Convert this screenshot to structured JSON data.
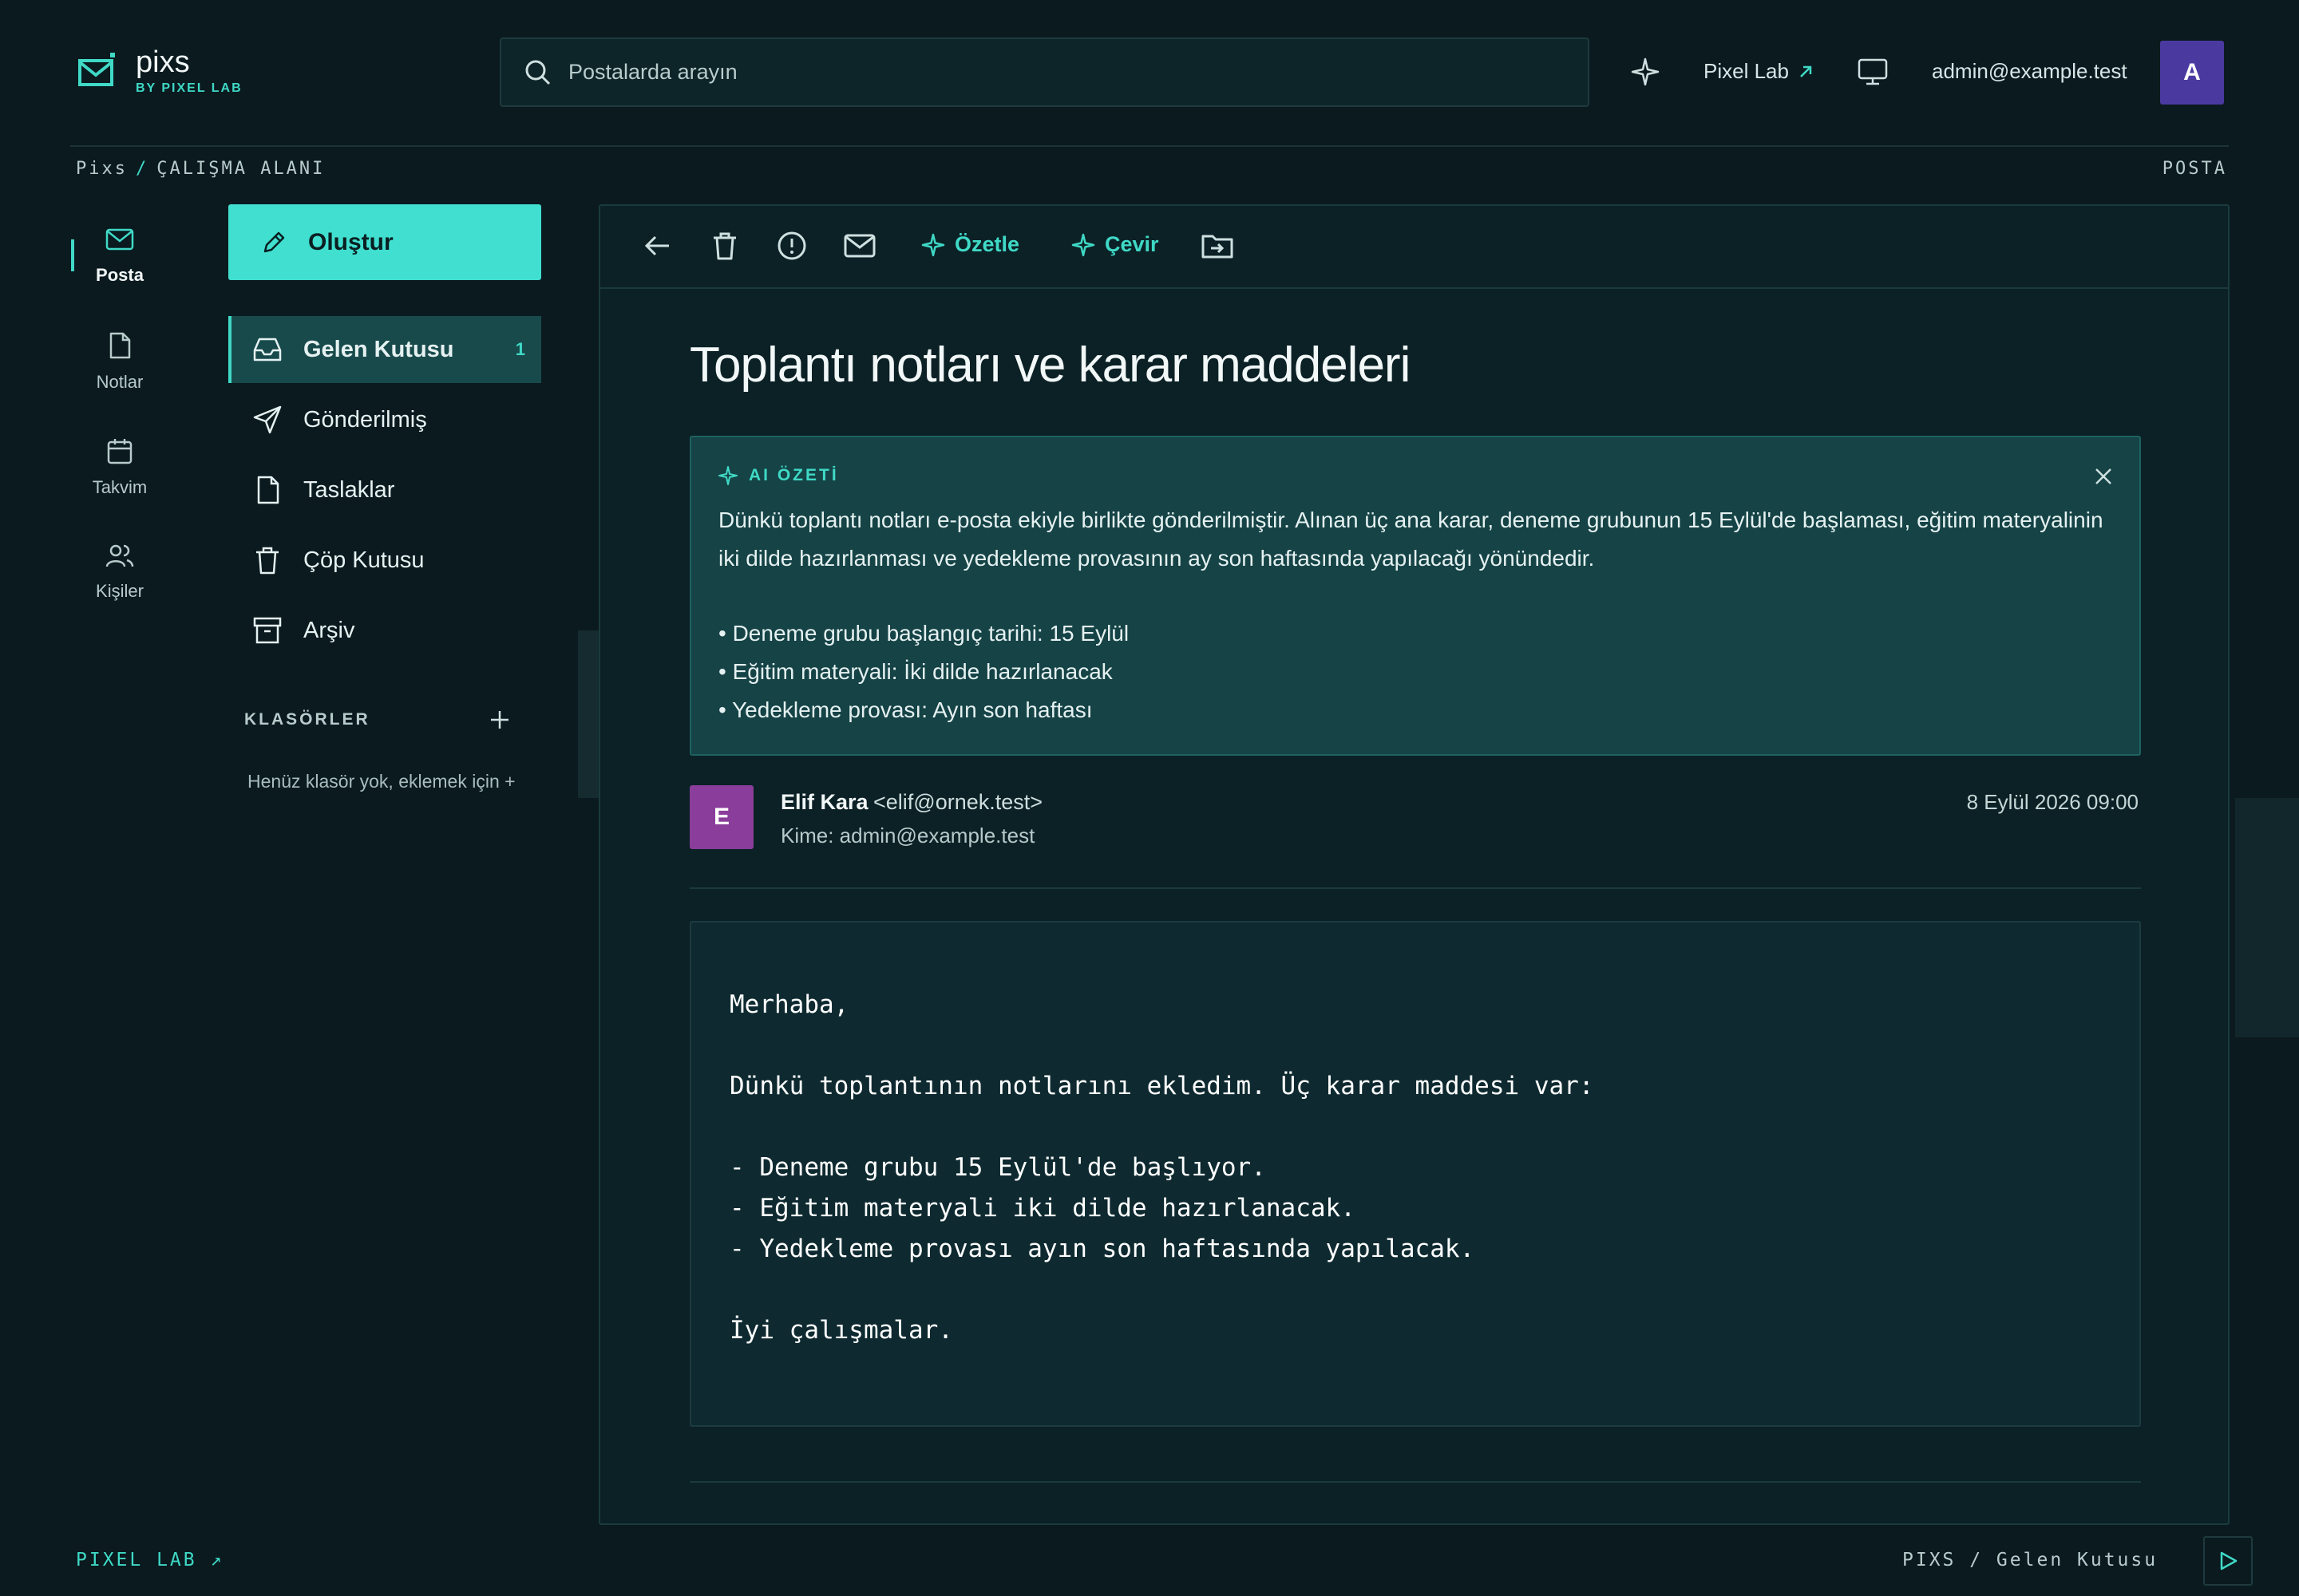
{
  "header": {
    "logo_name": "pixs",
    "logo_sub": "BY PIXEL LAB",
    "search_placeholder": "Postalarda arayın",
    "pixel_lab_link": "Pixel Lab",
    "user_email": "admin@example.test",
    "user_initial": "A"
  },
  "breadcrumb": {
    "root": "Pixs",
    "sep": "/",
    "current": "ÇALIŞMA ALANI",
    "section": "POSTA"
  },
  "rail": [
    {
      "label": "Posta",
      "icon": "mail-icon"
    },
    {
      "label": "Notlar",
      "icon": "note-icon"
    },
    {
      "label": "Takvim",
      "icon": "calendar-icon"
    },
    {
      "label": "Kişiler",
      "icon": "people-icon"
    }
  ],
  "sidebar": {
    "compose_label": "Oluştur",
    "nav": [
      {
        "label": "Gelen Kutusu",
        "count": "1",
        "icon": "inbox-icon"
      },
      {
        "label": "Gönderilmiş",
        "icon": "send-icon"
      },
      {
        "label": "Taslaklar",
        "icon": "draft-icon"
      },
      {
        "label": "Çöp Kutusu",
        "icon": "trash-icon"
      },
      {
        "label": "Arşiv",
        "icon": "archive-icon"
      }
    ],
    "folders_title": "KLASÖRLER",
    "folders_empty": "Henüz klasör yok, eklemek için +"
  },
  "toolbar": {
    "summarize_label": "Özetle",
    "translate_label": "Çevir"
  },
  "email": {
    "subject": "Toplantı notları ve karar maddeleri",
    "ai_title": "AI ÖZETİ",
    "ai_summary": "Dünkü toplantı notları e-posta ekiyle birlikte gönderilmiştir. Alınan üç ana karar, deneme grubunun 15 Eylül'de başlaması, eğitim materyalinin iki dilde hazırlanması ve yedekleme provasının ay son haftasında yapılacağı yönündedir.",
    "ai_bullets": [
      "• Deneme grubu başlangıç tarihi: 15 Eylül",
      "• Eğitim materyali: İki dilde hazırlanacak",
      "• Yedekleme provası: Ayın son haftası"
    ],
    "sender_initial": "E",
    "sender_name": "Elif Kara",
    "sender_email": "<elif@ornek.test>",
    "to": "Kime: admin@example.test",
    "date": "8 Eylül 2026 09:00",
    "body": "Merhaba,\n\nDünkü toplantının notlarını ekledim. Üç karar maddesi var:\n\n- Deneme grubu 15 Eylül'de başlıyor.\n- Eğitim materyali iki dilde hazırlanacak.\n- Yedekleme provası ayın son haftasında yapılacak.\n\nİyi çalışmalar."
  },
  "footer": {
    "left": "PIXEL LAB ↗",
    "right": "PIXS / Gelen Kutusu"
  },
  "colors": {
    "accent": "#3fd9c6",
    "background": "#0a1a1f",
    "panel": "#0b2126",
    "ai_box": "#154346",
    "avatar_user": "#4a3aa0",
    "avatar_sender": "#8a3d9a"
  }
}
